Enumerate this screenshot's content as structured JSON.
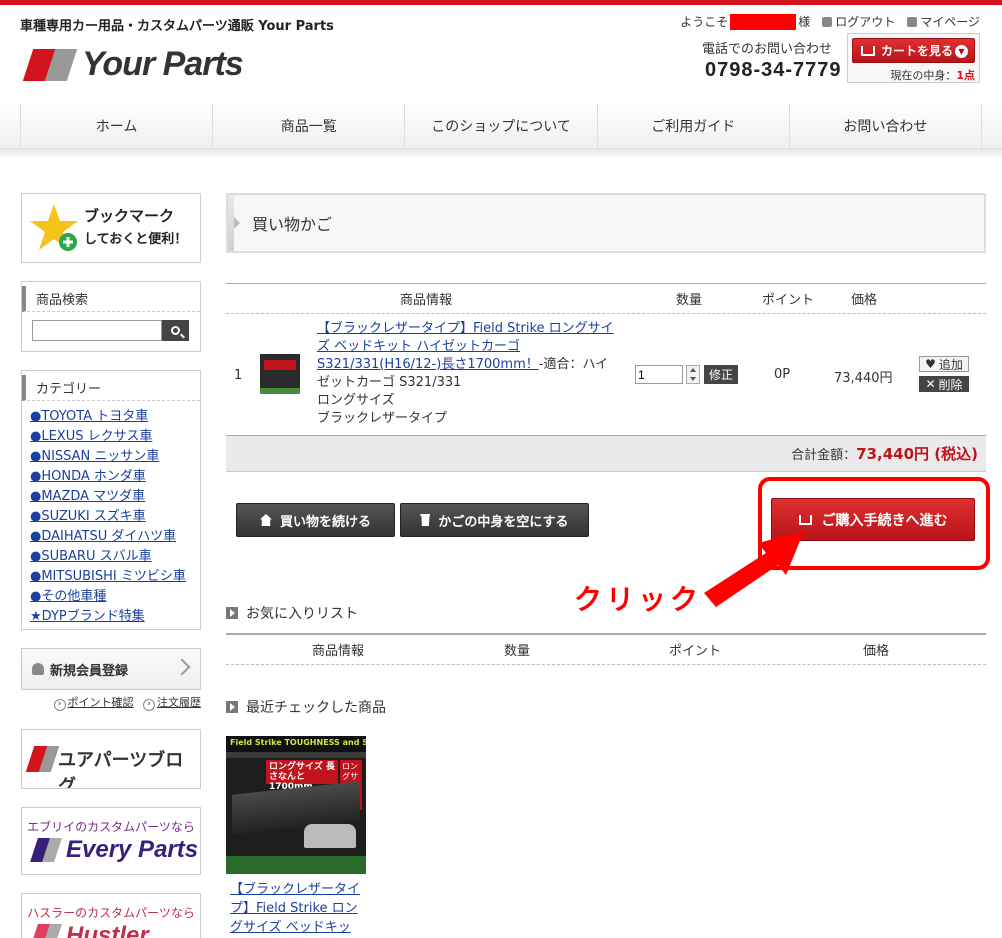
{
  "header": {
    "tagline": "車種専用カー用品・カスタムパーツ通販 Your Parts",
    "logo_text": "Your Parts",
    "welcome_prefix": "ようこそ",
    "welcome_suffix": "様",
    "logout": "ログアウト",
    "mypage": "マイページ",
    "phone_label": "電話でのお問い合わせ",
    "phone_number": "0798-34-7779",
    "cart_button": "カートを見る",
    "cart_now_label": "現在の中身：",
    "cart_count": "1点"
  },
  "nav": [
    "ホーム",
    "商品一覧",
    "このショップについて",
    "ご利用ガイド",
    "お問い合わせ"
  ],
  "sidebar": {
    "bookmark_line1": "ブックマーク",
    "bookmark_line2": "しておくと便利！",
    "search_title": "商品検索",
    "search_value": "",
    "category_title": "カテゴリー",
    "categories": [
      "●TOYOTA トヨタ車",
      "●LEXUS レクサス車",
      "●NISSAN ニッサン車",
      "●HONDA ホンダ車",
      "●MAZDA マツダ車",
      "●SUZUKI スズキ車",
      "●DAIHATSU ダイハツ車",
      "●SUBARU スバル車",
      "●MITSUBISHI ミツビシ車",
      "●その他車種",
      "★DYPブランド特集"
    ],
    "register": "新規会員登録",
    "point_link": "ポイント確認",
    "order_link": "注文履歴",
    "blog_banner": "ユアパーツブログ",
    "every_small": "エブリイのカスタムパーツなら",
    "every_big": "Every Parts",
    "hustler_small": "ハスラーのカスタムパーツなら",
    "hustler_big": "Hustler Parts"
  },
  "main": {
    "page_title": "買い物かご",
    "columns": [
      "商品情報",
      "数量",
      "ポイント",
      "価格"
    ],
    "item": {
      "number": "1",
      "link_text": "【ブラックレザータイプ】Field Strike ロングサイズ ベッドキット ハイゼットカーゴ S321/331(H16/12-)長さ1700mm！",
      "suffix_text": "-適合：ハイゼットカーゴ S321/331",
      "option1": "ロングサイズ",
      "option2": "ブラックレザータイプ",
      "quantity": "1",
      "fix_button": "修正",
      "points": "0P",
      "price": "73,440円",
      "add_button": "追加",
      "delete_button": "削除"
    },
    "total_label": "合計金額：",
    "total_value": "73,440円 (税込)",
    "continue_button": "買い物を続ける",
    "empty_button": "かごの中身を空にする",
    "checkout_button": "ご購入手続きへ進む",
    "annotation_label": "クリック",
    "favorites_title": "お気に入りリスト",
    "fav_columns": [
      "商品情報",
      "数量",
      "ポイント",
      "価格"
    ],
    "recent_title": "最近チェックした商品",
    "recent_image_top": "Field Strike TOUGHNESS and SILENCE BEDKIT",
    "recent_image_red": "ロングサイズ 長さなんと1700mm",
    "recent_image_side": "ロングサイズ",
    "recent_caption": "【ブラックレザータイプ】Field Strike ロングサイズ ベッドキッ"
  },
  "colors": {
    "brand_red": "#d4141c",
    "link_blue": "#1a3fa0",
    "annotation_red": "#ff0000"
  }
}
